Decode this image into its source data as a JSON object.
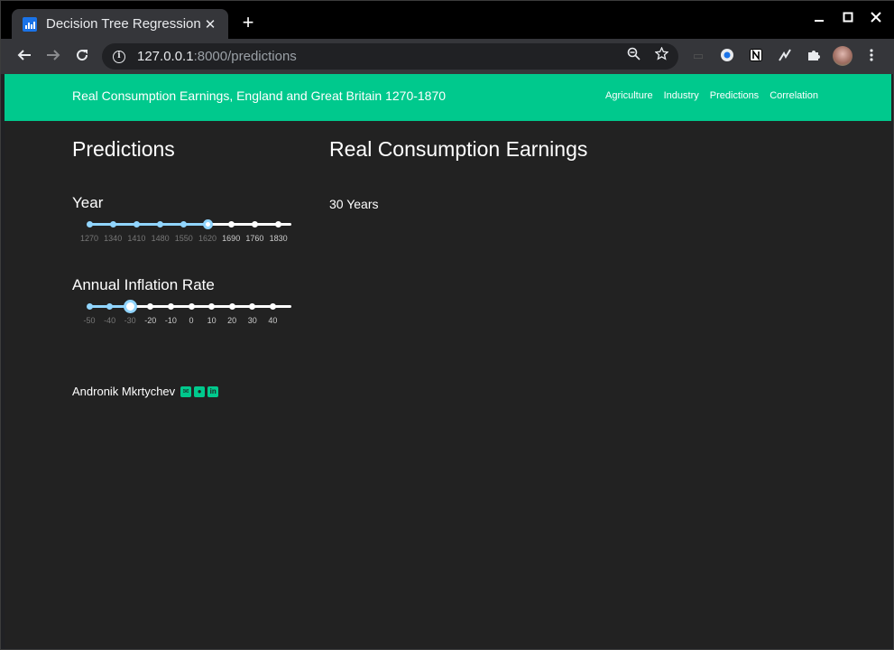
{
  "browser": {
    "tab_title": "Decision Tree Regression",
    "tab_close": "✕",
    "new_tab": "+",
    "url_host": "127.0.0.1",
    "url_rest": ":8000/predictions",
    "icons": [
      "back-arrow-icon",
      "forward-arrow-icon",
      "reload-icon",
      "info-icon",
      "zoom-out-icon",
      "star-icon",
      "extension-icons",
      "puzzle-icon",
      "kebab-menu-icon"
    ]
  },
  "navbar": {
    "brand": "Real Consumption Earnings, England and Great Britain 1270-1870",
    "links": [
      "Agriculture",
      "Industry",
      "Predictions",
      "Correlation"
    ],
    "color": "#00c98d"
  },
  "sidebar": {
    "title": "Predictions",
    "year": {
      "label": "Year",
      "marks": [
        "1270",
        "1340",
        "1410",
        "1480",
        "1550",
        "1620",
        "1690",
        "1760",
        "1830"
      ],
      "selected": "1620"
    },
    "inflation": {
      "label": "Annual Inflation Rate",
      "marks": [
        "-50",
        "-40",
        "-30",
        "-20",
        "-10",
        "0",
        "10",
        "20",
        "30",
        "40"
      ],
      "selected": "-30"
    },
    "author": "Andronik Mkrtychev",
    "social_icons": [
      "email-icon",
      "github-icon",
      "linkedin-icon"
    ]
  },
  "main": {
    "title": "Real Consumption Earnings",
    "subtitle": "30 Years"
  },
  "colors": {
    "page_bg": "#222222",
    "accent": "#00c98d",
    "slider_active": "#91d5ff"
  }
}
